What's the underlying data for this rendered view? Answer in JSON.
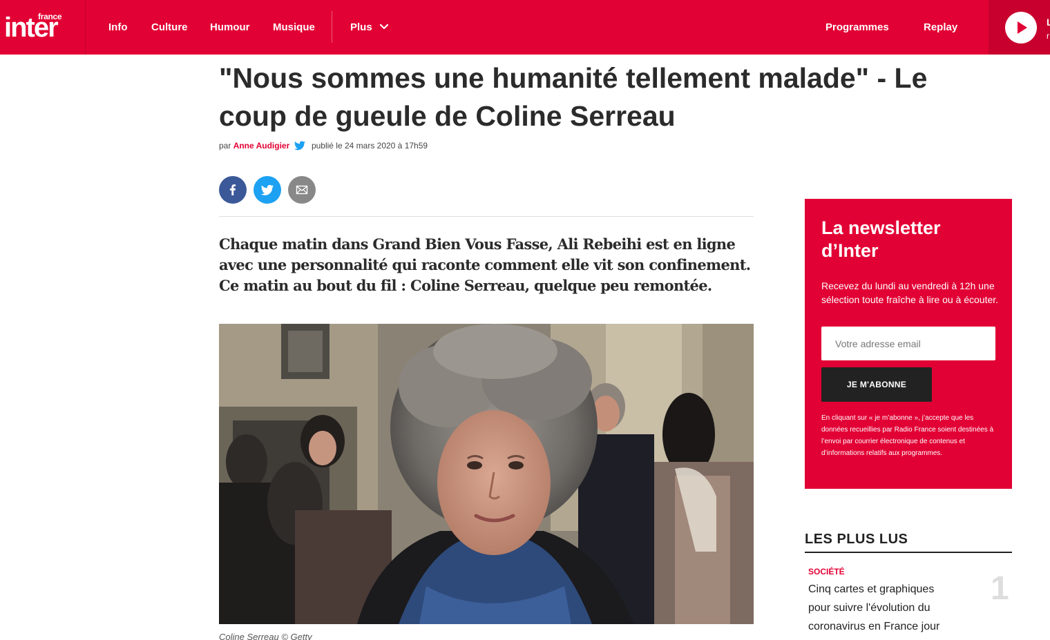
{
  "header": {
    "logo_small": "france",
    "logo_big": "inter",
    "nav": [
      "Info",
      "Culture",
      "Humour",
      "Musique",
      "Plus"
    ],
    "right_links": [
      "Programmes",
      "Replay"
    ],
    "player_label": "L",
    "player_sub": "r",
    "brand_color": "#e20134"
  },
  "article": {
    "title": "\"Nous sommes une humanité tellement malade\" - Le coup de gueule de Coline Serreau",
    "by_prefix": "par",
    "author": "Anne Audigier",
    "published": "publié le 24 mars 2020 à 17h59",
    "share": [
      "facebook-icon",
      "twitter-icon",
      "mail-icon"
    ],
    "chapo": "Chaque matin dans Grand Bien Vous Fasse, Ali Rebeihi est en ligne avec une personnalité qui raconte comment elle vit son confinement. Ce matin au bout du fil : Coline Serreau, quelque peu remontée.",
    "caption": "Coline Serreau © Getty"
  },
  "newsletter": {
    "title": "La newsletter d’Inter",
    "description": "Recevez du lundi au vendredi à 12h une sélection toute fraîche à lire ou à écouter.",
    "email_placeholder": "Votre adresse email",
    "button": "JE M'ABONNE",
    "legal": "En cliquant sur « je m’abonne », j’accepte que les données recueillies par Radio France soient destinées à l’envoi par courrier électronique de contenus et d’informations relatifs aux programmes."
  },
  "most_read": {
    "title": "LES PLUS LUS",
    "items": [
      {
        "rank": "1",
        "category": "SOCIÉTÉ",
        "text": "Cinq cartes et graphiques pour suivre l'évolution du coronavirus en France jour"
      }
    ]
  }
}
